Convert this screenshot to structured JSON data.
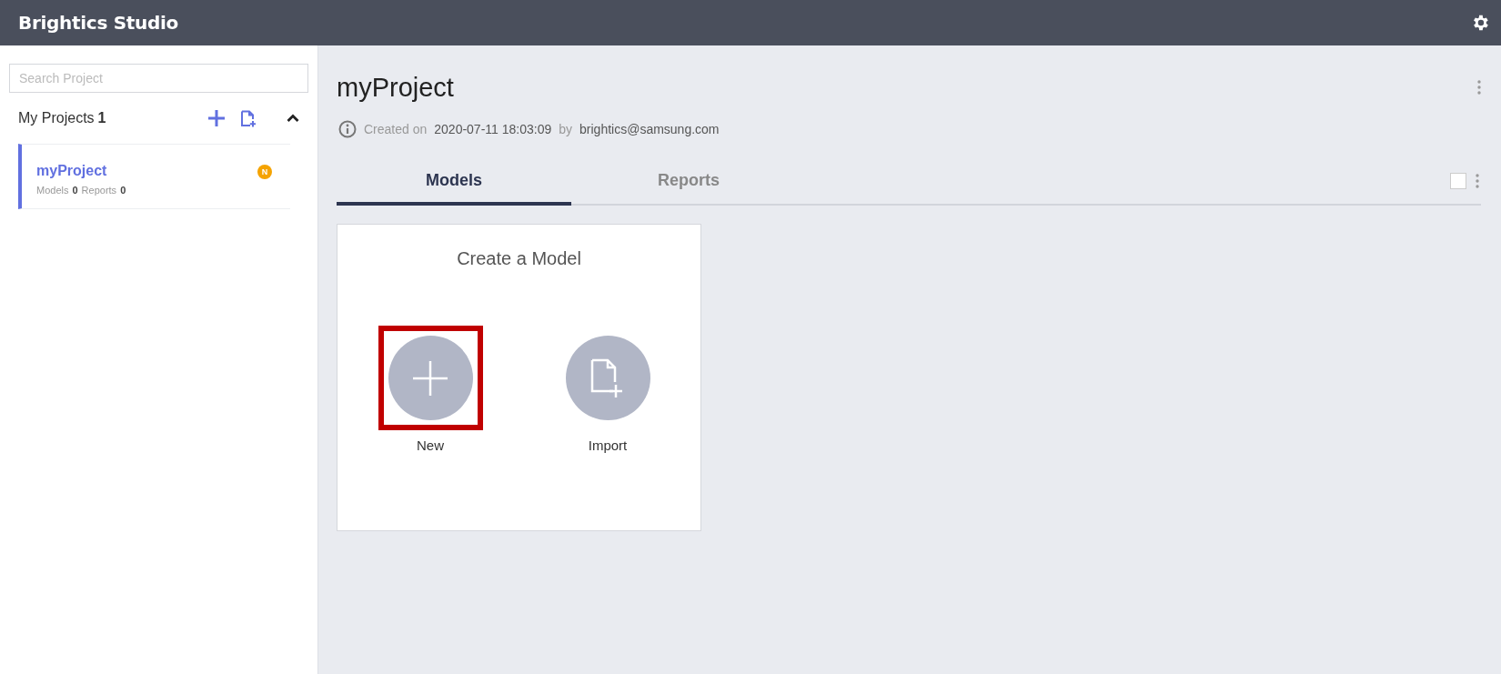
{
  "app_title": "Brightics Studio",
  "sidebar": {
    "search": {
      "placeholder": "Search Project"
    },
    "section_label": "My Projects",
    "section_count": "1",
    "expanded": true,
    "projects": [
      {
        "name": "myProject",
        "models_label": "Models",
        "models_count": "0",
        "reports_label": "Reports",
        "reports_count": "0",
        "badge": "N",
        "selected": true
      }
    ]
  },
  "project": {
    "title": "myProject",
    "created_label": "Created on",
    "created_at": "2020-07-11 18:03:09",
    "by_label": "by",
    "author": "brightics@samsung.com"
  },
  "tabs": [
    {
      "label": "Models",
      "selected": true
    },
    {
      "label": "Reports",
      "selected": false
    }
  ],
  "select_all": {
    "checked": false
  },
  "card": {
    "title": "Create a Model",
    "options": [
      {
        "kind": "new",
        "label": "New",
        "highlighted": true
      },
      {
        "kind": "import",
        "label": "Import",
        "highlighted": false
      }
    ]
  }
}
